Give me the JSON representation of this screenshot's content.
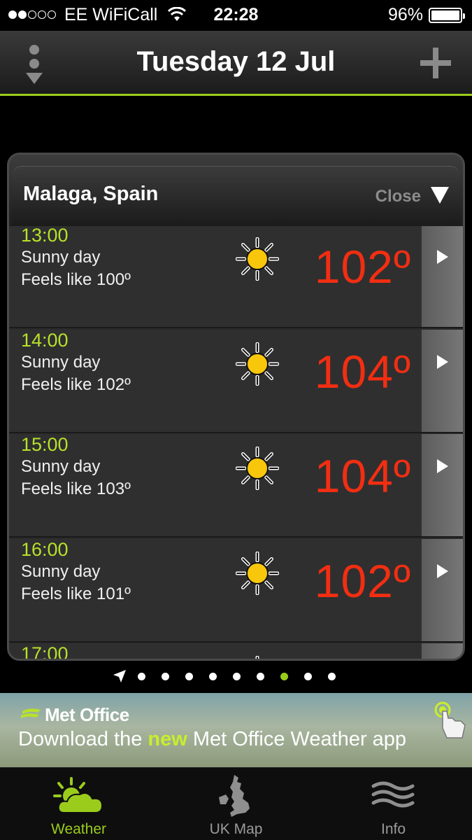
{
  "status_bar": {
    "carrier": "EE WiFiCall",
    "time": "22:28",
    "battery": "96%",
    "signal_bars_filled": 2,
    "signal_bars_total": 5
  },
  "header": {
    "title": "Tuesday 12 Jul",
    "menu_icon": "menu-dots-icon",
    "add_icon": "plus-icon"
  },
  "forecast": {
    "location": "Malaga, Spain",
    "close_label": "Close",
    "rows": [
      {
        "time": "13:00",
        "desc": "Sunny day",
        "feels": "Feels like 100º",
        "temp": "102º",
        "icon": "sun-icon"
      },
      {
        "time": "14:00",
        "desc": "Sunny day",
        "feels": "Feels like 102º",
        "temp": "104º",
        "icon": "sun-icon"
      },
      {
        "time": "15:00",
        "desc": "Sunny day",
        "feels": "Feels like 103º",
        "temp": "104º",
        "icon": "sun-icon"
      },
      {
        "time": "16:00",
        "desc": "Sunny day",
        "feels": "Feels like 101º",
        "temp": "102º",
        "icon": "sun-icon"
      },
      {
        "time": "17:00",
        "desc": "",
        "feels": "",
        "temp": "",
        "icon": "sun-icon"
      }
    ]
  },
  "pager": {
    "page_count": 9,
    "active_index": 6
  },
  "banner": {
    "brand": "Met Office",
    "tagline_pre": "Download the ",
    "tagline_highlight": "new",
    "tagline_post": " Met Office Weather app"
  },
  "tabs": [
    {
      "label": "Weather",
      "icon": "weather-icon",
      "active": true
    },
    {
      "label": "UK Map",
      "icon": "uk-map-icon",
      "active": false
    },
    {
      "label": "Info",
      "icon": "info-icon",
      "active": false
    }
  ],
  "colors": {
    "accent": "#9bcc1c",
    "temp": "#f22e12",
    "time": "#b7e12a"
  }
}
